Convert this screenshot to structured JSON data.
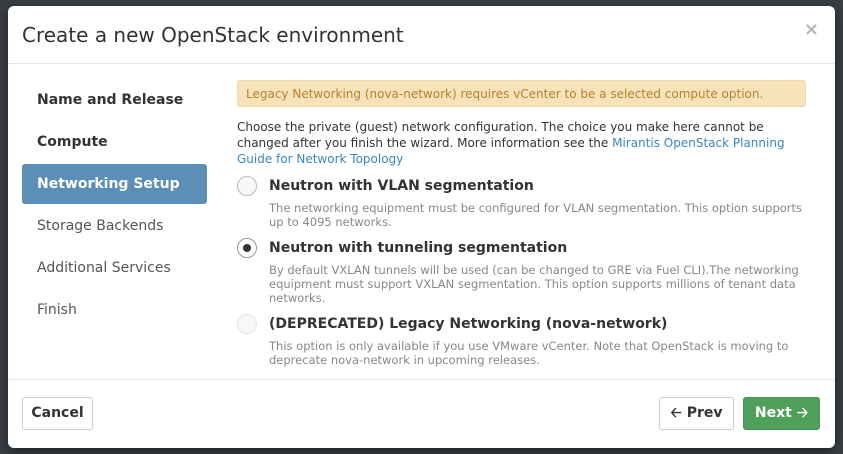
{
  "modal": {
    "title": "Create a new OpenStack environment",
    "close_glyph": "×"
  },
  "nav": {
    "items": [
      {
        "label": "Name and Release",
        "state": "done"
      },
      {
        "label": "Compute",
        "state": "done"
      },
      {
        "label": "Networking Setup",
        "state": "active"
      },
      {
        "label": "Storage Backends",
        "state": "pending"
      },
      {
        "label": "Additional Services",
        "state": "pending"
      },
      {
        "label": "Finish",
        "state": "pending"
      }
    ]
  },
  "alert": {
    "text": "Legacy Networking (nova-network) requires vCenter to be a selected compute option."
  },
  "intro": {
    "text": "Choose the private (guest) network configuration. The choice you make here cannot be changed after you finish the wizard. More information see the ",
    "link": "Mirantis OpenStack Planning Guide for Network Topology"
  },
  "options": [
    {
      "label": "Neutron with VLAN segmentation",
      "description": "The networking equipment must be configured for VLAN segmentation. This option supports up to 4095 networks.",
      "checked": false,
      "disabled": false
    },
    {
      "label": "Neutron with tunneling segmentation",
      "description": "By default VXLAN tunnels will be used (can be changed to GRE via Fuel CLI).The networking equipment must support VXLAN segmentation. This option supports millions of tenant data networks.",
      "checked": true,
      "disabled": false
    },
    {
      "label": "(DEPRECATED) Legacy Networking (nova-network)",
      "description": "This option is only available if you use VMware vCenter. Note that OpenStack is moving to deprecate nova-network in upcoming releases.",
      "checked": false,
      "disabled": true
    }
  ],
  "footer": {
    "cancel_label": "Cancel",
    "prev_label": "Prev",
    "next_label": "Next",
    "prev_arrow": "🡠",
    "next_arrow": "🡢"
  },
  "colors": {
    "active_nav": "#5c8fb8",
    "alert_bg": "#f6e3b9",
    "alert_text": "#b8812e",
    "link": "#3a87c0",
    "next_button": "#4fa05b"
  }
}
